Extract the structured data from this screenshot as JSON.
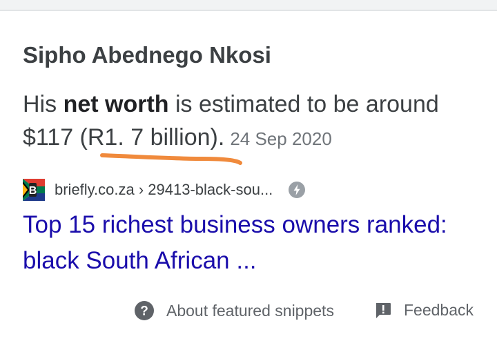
{
  "snippet": {
    "heading": "Sipho Abednego Nkosi",
    "text_before": "His ",
    "text_bold": "net worth",
    "text_after": " is estimated to be around $117 (R1. 7 billion).",
    "date": "24 Sep 2020"
  },
  "source": {
    "favicon_icon": "south-africa-flag-b-icon",
    "url": "briefly.co.za › 29413-black-sou...",
    "amp_icon": "lightning-bolt-icon"
  },
  "result": {
    "title": "Top 15 richest business owners ranked: black South African ..."
  },
  "footer": {
    "about_label": "About featured snippets",
    "feedback_label": "Feedback"
  },
  "colors": {
    "link": "#1a0dab",
    "text": "#3c4043",
    "muted": "#70757a",
    "highlight": "#f08a3c"
  }
}
